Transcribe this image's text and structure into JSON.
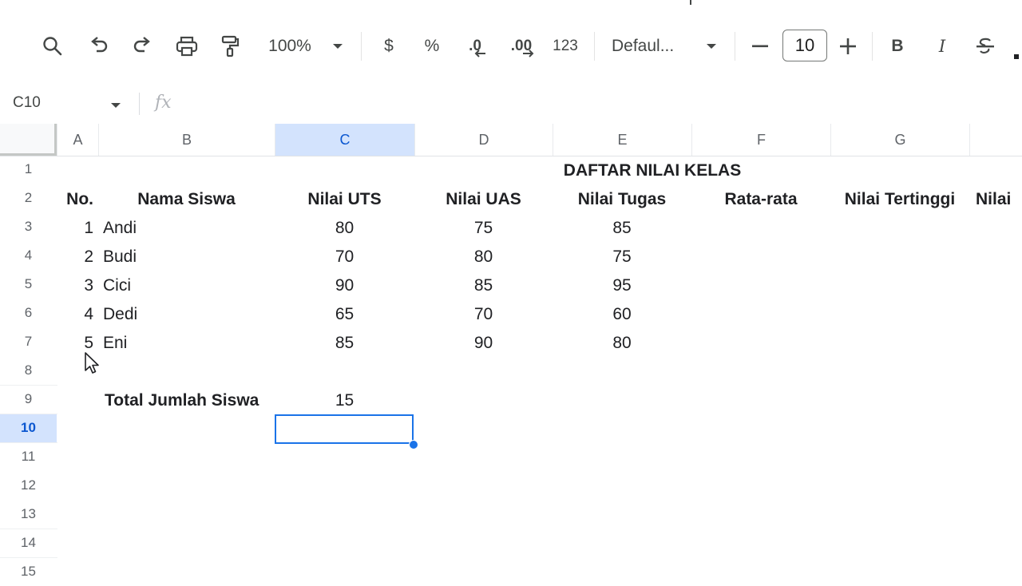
{
  "toolbar": {
    "zoom": "100%",
    "currency": "$",
    "percent": "%",
    "decrease_decimal": ".0",
    "increase_decimal": ".00",
    "number_format": "123",
    "font_family": "Defaul...",
    "font_size": "10",
    "bold": "B",
    "italic": "I"
  },
  "formula_bar": {
    "cell_ref": "C10",
    "fx": "fx"
  },
  "columns": [
    "A",
    "B",
    "C",
    "D",
    "E",
    "F",
    "G"
  ],
  "rows": [
    "1",
    "2",
    "3",
    "4",
    "5",
    "6",
    "7",
    "8",
    "9",
    "10",
    "11",
    "12",
    "13",
    "14",
    "15"
  ],
  "sheet": {
    "title": "DAFTAR NILAI KELAS",
    "headers": {
      "no": "No.",
      "name": "Nama Siswa",
      "uts": "Nilai UTS",
      "uas": "Nilai UAS",
      "tugas": "Nilai Tugas",
      "avg": "Rata-rata",
      "max": "Nilai Tertinggi",
      "next": "Nilai"
    },
    "students": [
      {
        "no": "1",
        "name": "Andi",
        "uts": "80",
        "uas": "75",
        "tugas": "85"
      },
      {
        "no": "2",
        "name": "Budi",
        "uts": "70",
        "uas": "80",
        "tugas": "75"
      },
      {
        "no": "3",
        "name": "Cici",
        "uts": "90",
        "uas": "85",
        "tugas": "95"
      },
      {
        "no": "4",
        "name": "Dedi",
        "uts": "65",
        "uas": "70",
        "tugas": "60"
      },
      {
        "no": "5",
        "name": "Eni",
        "uts": "85",
        "uas": "90",
        "tugas": "80"
      }
    ],
    "total_label": "Total Jumlah Siswa",
    "total_value": "15"
  },
  "selection": {
    "active_cell": "C10",
    "active_column": "C",
    "active_row": "10"
  },
  "colors": {
    "accent": "#1a73e8",
    "header_active": "#d3e3fd"
  }
}
